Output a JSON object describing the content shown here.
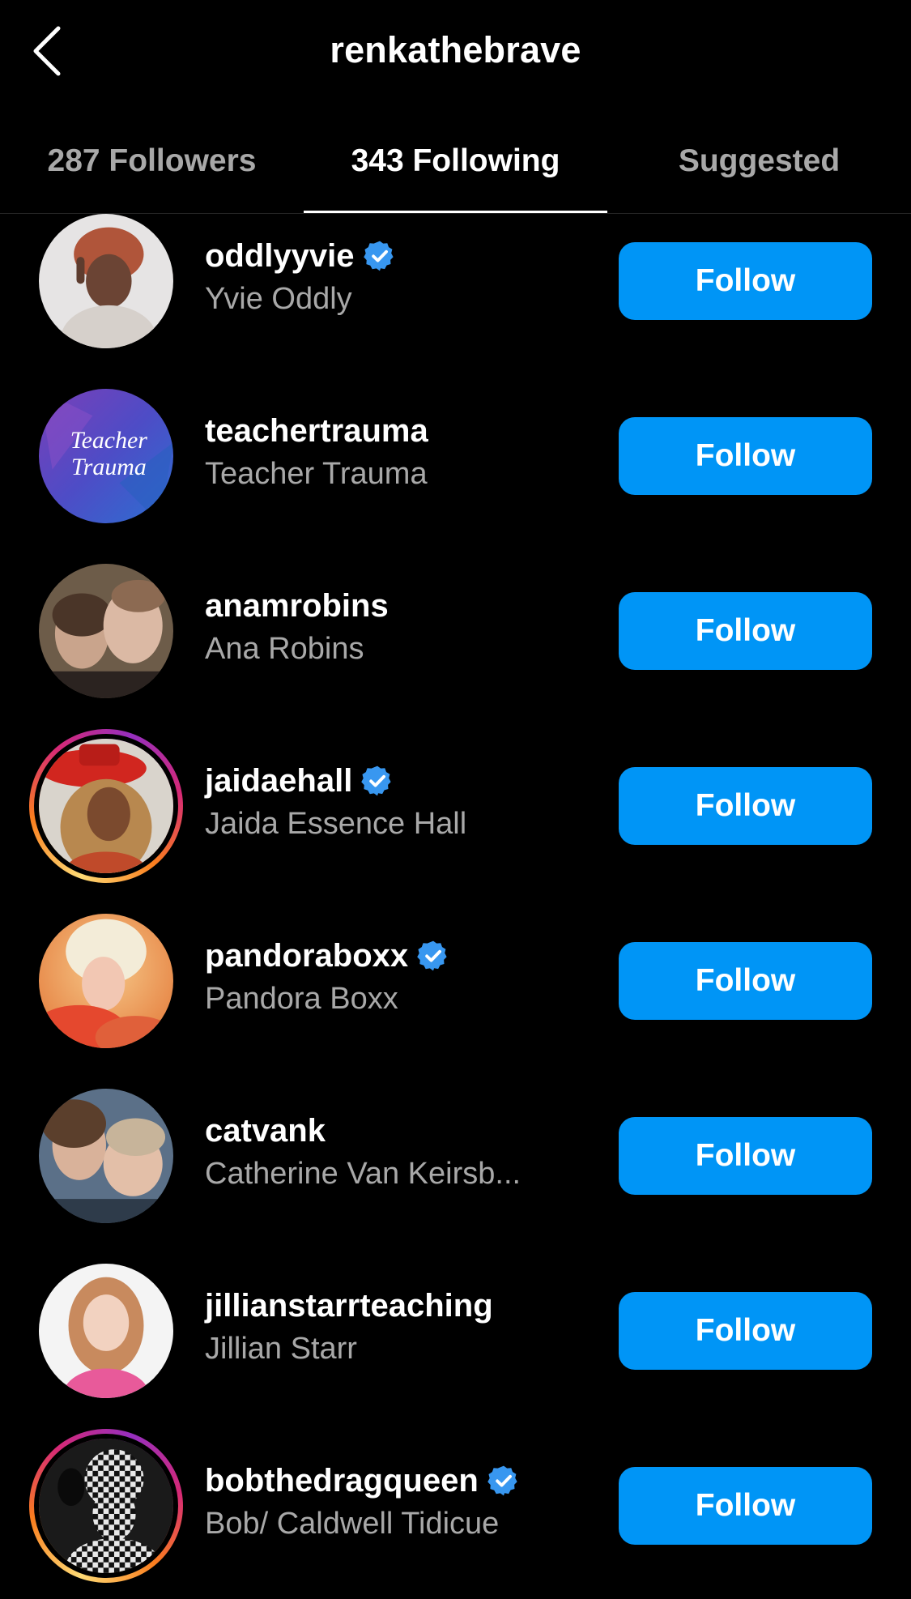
{
  "header": {
    "title": "renkathebrave"
  },
  "tabs": [
    {
      "label": "287 Followers",
      "active": false
    },
    {
      "label": "343 Following",
      "active": true
    },
    {
      "label": "Suggested",
      "active": false
    }
  ],
  "colors": {
    "background": "#000000",
    "primary_text": "#ffffff",
    "secondary_text": "#a8a8a8",
    "follow_button": "#0095f6",
    "verified_badge": "#3897f0"
  },
  "accounts": [
    {
      "username": "oddlyyvie",
      "full_name": "Yvie Oddly",
      "verified": true,
      "story_ring": false,
      "button_label": "Follow"
    },
    {
      "username": "teachertrauma",
      "full_name": "Teacher Trauma",
      "verified": false,
      "story_ring": false,
      "button_label": "Follow",
      "avatar_text_1": "Teacher",
      "avatar_text_2": "Trauma"
    },
    {
      "username": "anamrobins",
      "full_name": "Ana Robins",
      "verified": false,
      "story_ring": false,
      "button_label": "Follow"
    },
    {
      "username": "jaidaehall",
      "full_name": "Jaida Essence Hall",
      "verified": true,
      "story_ring": true,
      "button_label": "Follow"
    },
    {
      "username": "pandoraboxx",
      "full_name": "Pandora Boxx",
      "verified": true,
      "story_ring": false,
      "button_label": "Follow"
    },
    {
      "username": "catvank",
      "full_name": "Catherine Van Keirsb...",
      "verified": false,
      "story_ring": false,
      "button_label": "Follow"
    },
    {
      "username": "jillianstarrteaching",
      "full_name": "Jillian Starr",
      "verified": false,
      "story_ring": false,
      "button_label": "Follow"
    },
    {
      "username": "bobthedragqueen",
      "full_name": "Bob/ Caldwell Tidicue",
      "verified": true,
      "story_ring": true,
      "button_label": "Follow"
    }
  ]
}
